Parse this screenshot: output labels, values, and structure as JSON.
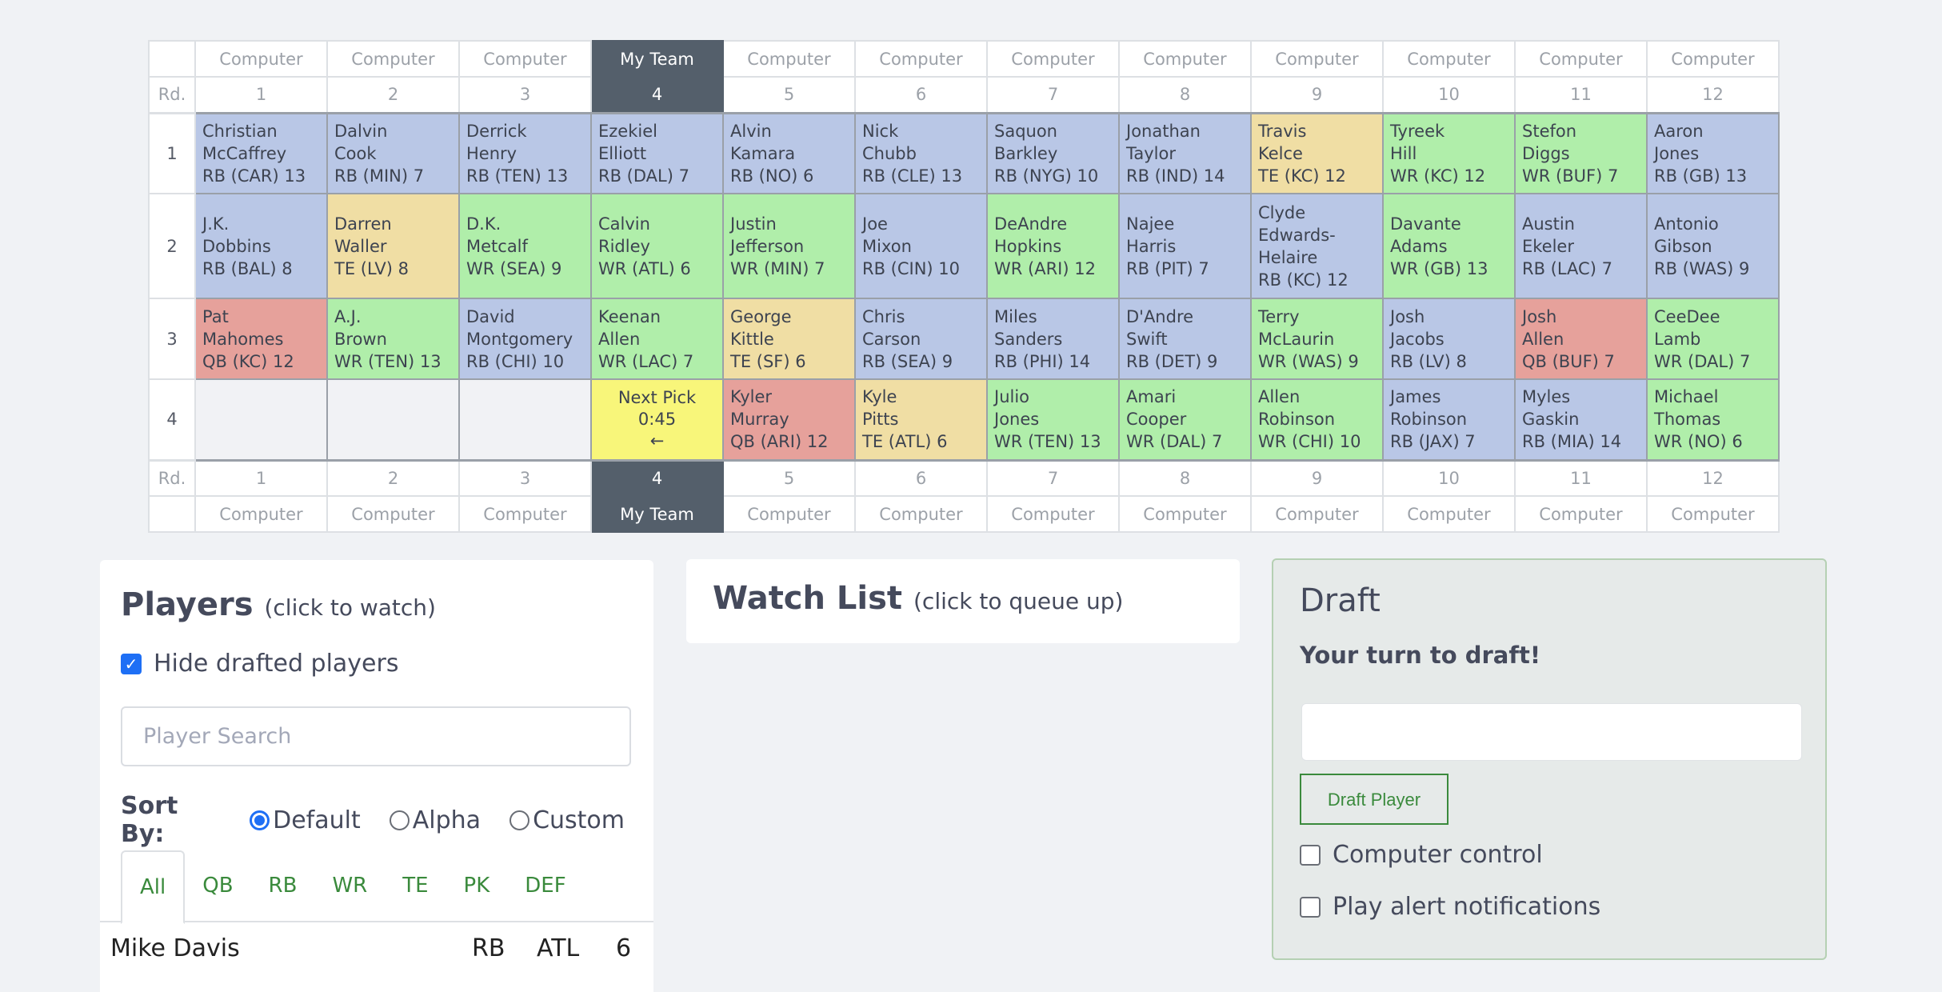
{
  "board": {
    "round_label": "Rd.",
    "teams": [
      "Computer",
      "Computer",
      "Computer",
      "My Team",
      "Computer",
      "Computer",
      "Computer",
      "Computer",
      "Computer",
      "Computer",
      "Computer",
      "Computer"
    ],
    "slots": [
      "1",
      "2",
      "3",
      "4",
      "5",
      "6",
      "7",
      "8",
      "9",
      "10",
      "11",
      "12"
    ],
    "my_slot_index": 3,
    "rounds": [
      {
        "round": "1",
        "picks": [
          {
            "first": "Christian",
            "last": "McCaffrey",
            "info": "RB (CAR) 13",
            "pos": "RB"
          },
          {
            "first": "Dalvin",
            "last": "Cook",
            "info": "RB (MIN) 7",
            "pos": "RB"
          },
          {
            "first": "Derrick",
            "last": "Henry",
            "info": "RB (TEN) 13",
            "pos": "RB"
          },
          {
            "first": "Ezekiel",
            "last": "Elliott",
            "info": "RB (DAL) 7",
            "pos": "RB"
          },
          {
            "first": "Alvin",
            "last": "Kamara",
            "info": "RB (NO) 6",
            "pos": "RB"
          },
          {
            "first": "Nick",
            "last": "Chubb",
            "info": "RB (CLE) 13",
            "pos": "RB"
          },
          {
            "first": "Saquon",
            "last": "Barkley",
            "info": "RB (NYG) 10",
            "pos": "RB"
          },
          {
            "first": "Jonathan",
            "last": "Taylor",
            "info": "RB (IND) 14",
            "pos": "RB"
          },
          {
            "first": "Travis",
            "last": "Kelce",
            "info": "TE (KC) 12",
            "pos": "TE"
          },
          {
            "first": "Tyreek",
            "last": "Hill",
            "info": "WR (KC) 12",
            "pos": "WR"
          },
          {
            "first": "Stefon",
            "last": "Diggs",
            "info": "WR (BUF) 7",
            "pos": "WR"
          },
          {
            "first": "Aaron",
            "last": "Jones",
            "info": "RB (GB) 13",
            "pos": "RB"
          }
        ]
      },
      {
        "round": "2",
        "picks": [
          {
            "first": "J.K.",
            "last": "Dobbins",
            "info": "RB (BAL) 8",
            "pos": "RB"
          },
          {
            "first": "Darren",
            "last": "Waller",
            "info": "TE (LV) 8",
            "pos": "TE"
          },
          {
            "first": "D.K.",
            "last": "Metcalf",
            "info": "WR (SEA) 9",
            "pos": "WR"
          },
          {
            "first": "Calvin",
            "last": "Ridley",
            "info": "WR (ATL) 6",
            "pos": "WR"
          },
          {
            "first": "Justin",
            "last": "Jefferson",
            "info": "WR (MIN) 7",
            "pos": "WR"
          },
          {
            "first": "Joe",
            "last": "Mixon",
            "info": "RB (CIN) 10",
            "pos": "RB"
          },
          {
            "first": "DeAndre",
            "last": "Hopkins",
            "info": "WR (ARI) 12",
            "pos": "WR"
          },
          {
            "first": "Najee",
            "last": "Harris",
            "info": "RB (PIT) 7",
            "pos": "RB"
          },
          {
            "first": "Clyde",
            "last": "Edwards-Helaire",
            "info": "RB (KC) 12",
            "pos": "RB"
          },
          {
            "first": "Davante",
            "last": "Adams",
            "info": "WR (GB) 13",
            "pos": "WR"
          },
          {
            "first": "Austin",
            "last": "Ekeler",
            "info": "RB (LAC) 7",
            "pos": "RB"
          },
          {
            "first": "Antonio",
            "last": "Gibson",
            "info": "RB (WAS) 9",
            "pos": "RB"
          }
        ]
      },
      {
        "round": "3",
        "picks": [
          {
            "first": "Pat",
            "last": "Mahomes",
            "info": "QB (KC) 12",
            "pos": "QB"
          },
          {
            "first": "A.J.",
            "last": "Brown",
            "info": "WR (TEN) 13",
            "pos": "WR"
          },
          {
            "first": "David",
            "last": "Montgomery",
            "info": "RB (CHI) 10",
            "pos": "RB"
          },
          {
            "first": "Keenan",
            "last": "Allen",
            "info": "WR (LAC) 7",
            "pos": "WR"
          },
          {
            "first": "George",
            "last": "Kittle",
            "info": "TE (SF) 6",
            "pos": "TE"
          },
          {
            "first": "Chris",
            "last": "Carson",
            "info": "RB (SEA) 9",
            "pos": "RB"
          },
          {
            "first": "Miles",
            "last": "Sanders",
            "info": "RB (PHI) 14",
            "pos": "RB"
          },
          {
            "first": "D'Andre",
            "last": "Swift",
            "info": "RB (DET) 9",
            "pos": "RB"
          },
          {
            "first": "Terry",
            "last": "McLaurin",
            "info": "WR (WAS) 9",
            "pos": "WR"
          },
          {
            "first": "Josh",
            "last": "Jacobs",
            "info": "RB (LV) 8",
            "pos": "RB"
          },
          {
            "first": "Josh",
            "last": "Allen",
            "info": "QB (BUF) 7",
            "pos": "QB"
          },
          {
            "first": "CeeDee",
            "last": "Lamb",
            "info": "WR (DAL) 7",
            "pos": "WR"
          }
        ]
      },
      {
        "round": "4",
        "picks": [
          {
            "pos": "empty"
          },
          {
            "pos": "empty"
          },
          {
            "pos": "empty"
          },
          {
            "pos": "next",
            "label": "Next Pick",
            "timer": "0:45",
            "arrow": "←"
          },
          {
            "first": "Kyler",
            "last": "Murray",
            "info": "QB (ARI) 12",
            "pos": "QB"
          },
          {
            "first": "Kyle",
            "last": "Pitts",
            "info": "TE (ATL) 6",
            "pos": "TE"
          },
          {
            "first": "Julio",
            "last": "Jones",
            "info": "WR (TEN) 13",
            "pos": "WR"
          },
          {
            "first": "Amari",
            "last": "Cooper",
            "info": "WR (DAL) 7",
            "pos": "WR"
          },
          {
            "first": "Allen",
            "last": "Robinson",
            "info": "WR (CHI) 10",
            "pos": "WR"
          },
          {
            "first": "James",
            "last": "Robinson",
            "info": "RB (JAX) 7",
            "pos": "RB"
          },
          {
            "first": "Myles",
            "last": "Gaskin",
            "info": "RB (MIA) 14",
            "pos": "RB"
          },
          {
            "first": "Michael",
            "last": "Thomas",
            "info": "WR (NO) 6",
            "pos": "WR"
          }
        ]
      }
    ],
    "position_colors": {
      "RB": "#b9c7e6",
      "WR": "#b0eeaa",
      "TE": "#f0dea4",
      "QB": "#e6a19b"
    }
  },
  "players_panel": {
    "title": "Players",
    "subtitle": "(click to watch)",
    "hide_drafted_label": "Hide drafted players",
    "hide_drafted_checked": true,
    "search_placeholder": "Player Search",
    "search_value": "",
    "sort_label": "Sort By:",
    "sort_options": [
      "Default",
      "Alpha",
      "Custom"
    ],
    "sort_selected": "Default",
    "tabs": [
      "All",
      "QB",
      "RB",
      "WR",
      "TE",
      "PK",
      "DEF"
    ],
    "active_tab": "All",
    "rows": [
      {
        "name": "Mike Davis",
        "pos": "RB",
        "team": "ATL",
        "bye": "6"
      }
    ]
  },
  "watch_panel": {
    "title": "Watch List",
    "subtitle": "(click to queue up)"
  },
  "draft_panel": {
    "title": "Draft",
    "status": "Your turn to draft!",
    "input_value": "",
    "draft_button": "Draft Player",
    "computer_control_label": "Computer control",
    "computer_control_checked": false,
    "alerts_label": "Play alert notifications",
    "alerts_checked": false
  }
}
